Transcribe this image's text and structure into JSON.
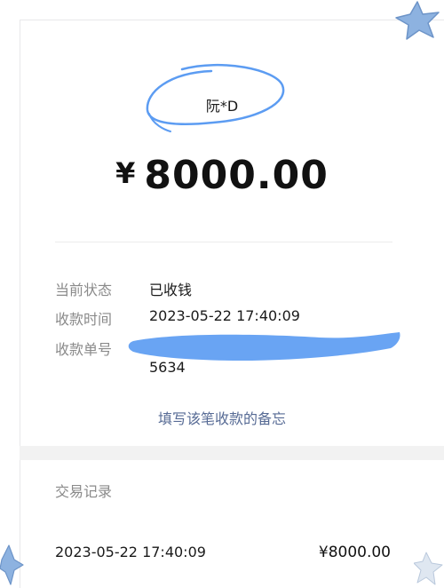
{
  "payer": {
    "name": "阮*D"
  },
  "amount": {
    "currency_symbol": "¥",
    "value": "8000.00"
  },
  "details": {
    "status_label": "当前状态",
    "status_value": "已收钱",
    "time_label": "收款时间",
    "time_value": "2023-05-22 17:40:09",
    "order_label": "收款单号",
    "order_value_tail": "5634"
  },
  "note_link": "填写该笔收款的备忘",
  "records": {
    "title": "交易记录",
    "items": [
      {
        "date": "2023-05-22 17:40:09",
        "amount": "¥8000.00"
      }
    ]
  },
  "colors": {
    "link": "#576b95",
    "scribble": "#5c9cf2",
    "star": "#7fa8d8"
  }
}
